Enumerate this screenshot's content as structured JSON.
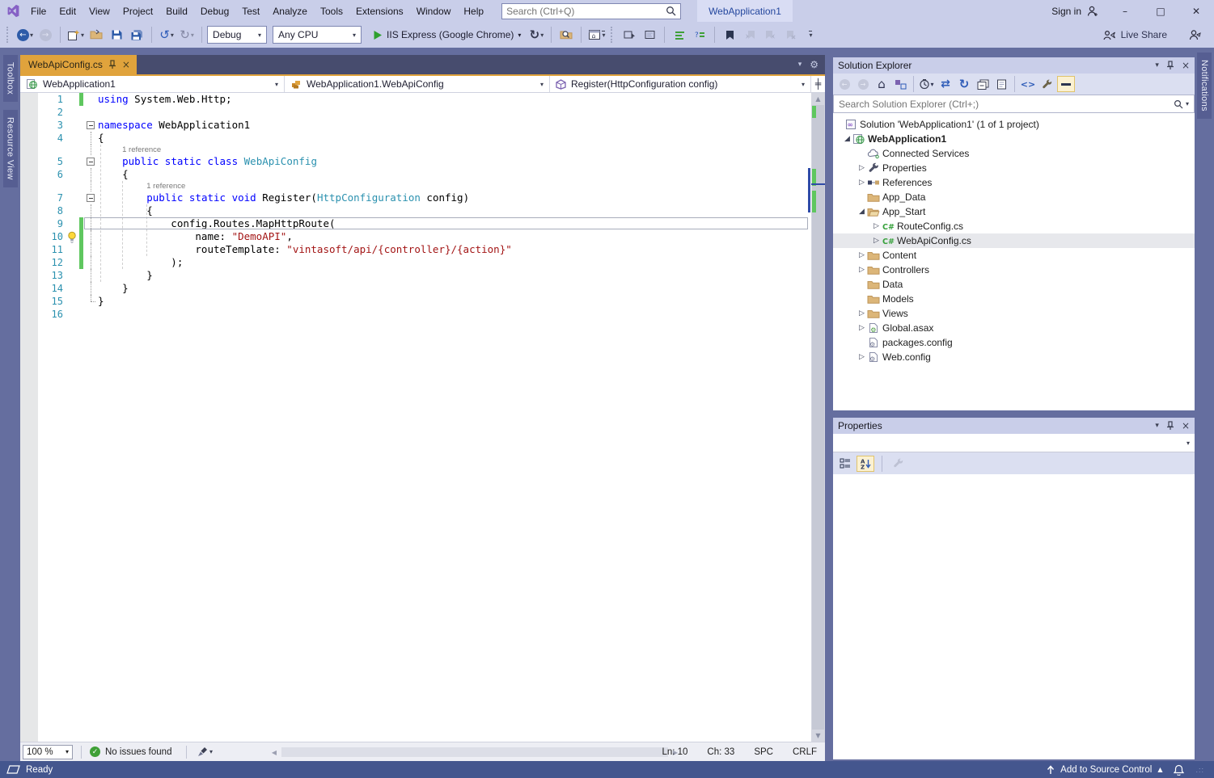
{
  "title_bar": {
    "menus": [
      "File",
      "Edit",
      "View",
      "Project",
      "Build",
      "Debug",
      "Test",
      "Analyze",
      "Tools",
      "Extensions",
      "Window",
      "Help"
    ],
    "search_placeholder": "Search (Ctrl+Q)",
    "window_title": "WebApplication1",
    "sign_in_label": "Sign in"
  },
  "toolbar": {
    "debug_config": "Debug",
    "platform": "Any CPU",
    "start_label": "IIS Express (Google Chrome)",
    "live_share_label": "Live Share",
    "icon_names": [
      "navigate-backward",
      "navigate-forward",
      "new-item",
      "open-file",
      "save",
      "save-all",
      "undo",
      "redo",
      "start-debug",
      "hot-reload",
      "find-in-files",
      "web-browser-home",
      "display-member-list",
      "display-parameter-info",
      "comment-out",
      "uncomment",
      "toggle-bookmark",
      "previous-bookmark",
      "next-bookmark",
      "clear-bookmarks",
      "toolbar-overflow",
      "live-share",
      "send-feedback"
    ]
  },
  "left_dock_tabs": [
    "Toolbox",
    "Resource View"
  ],
  "right_dock_tabs": [
    "Notifications"
  ],
  "editor": {
    "tab_label": "WebApiConfig.cs",
    "nav": {
      "project": "WebApplication1",
      "type": "WebApplication1.WebApiConfig",
      "member": "Register(HttpConfiguration config)"
    },
    "codelens_label": "1 reference",
    "lines": [
      {
        "n": "1",
        "bar": true,
        "segs": [
          [
            "k",
            "using"
          ],
          [
            "p",
            " System.Web.Http;"
          ]
        ]
      },
      {
        "n": "2",
        "segs": []
      },
      {
        "n": "3",
        "out": "box",
        "segs": [
          [
            "k",
            "namespace"
          ],
          [
            "p",
            " WebApplication1"
          ]
        ]
      },
      {
        "n": "4",
        "out": "v",
        "segs": [
          [
            "p",
            "{"
          ]
        ]
      },
      {
        "lens": true,
        "indent": 4
      },
      {
        "n": "5",
        "out": "box",
        "segs": [
          [
            "p",
            "    "
          ],
          [
            "k",
            "public"
          ],
          [
            "p",
            " "
          ],
          [
            "k",
            "static"
          ],
          [
            "p",
            " "
          ],
          [
            "k",
            "class"
          ],
          [
            "p",
            " "
          ],
          [
            "t",
            "WebApiConfig"
          ]
        ]
      },
      {
        "n": "6",
        "out": "v",
        "segs": [
          [
            "p",
            "    {"
          ]
        ]
      },
      {
        "lens": true,
        "indent": 8
      },
      {
        "n": "7",
        "out": "box",
        "segs": [
          [
            "p",
            "        "
          ],
          [
            "k",
            "public"
          ],
          [
            "p",
            " "
          ],
          [
            "k",
            "static"
          ],
          [
            "p",
            " "
          ],
          [
            "k",
            "void"
          ],
          [
            "p",
            " Register("
          ],
          [
            "t",
            "HttpConfiguration"
          ],
          [
            "p",
            " config)"
          ]
        ]
      },
      {
        "n": "8",
        "out": "v",
        "segs": [
          [
            "p",
            "        {"
          ]
        ]
      },
      {
        "n": "9",
        "out": "v",
        "bar": true,
        "segs": [
          [
            "p",
            "            config.Routes.MapHttpRoute("
          ]
        ]
      },
      {
        "n": "10",
        "out": "v",
        "bar": true,
        "bulb": true,
        "current": true,
        "segs": [
          [
            "p",
            "                name: "
          ],
          [
            "s",
            "\"DemoAPI\""
          ],
          [
            "p",
            ","
          ]
        ]
      },
      {
        "n": "11",
        "out": "v",
        "bar": true,
        "segs": [
          [
            "p",
            "                routeTemplate: "
          ],
          [
            "s",
            "\"vintasoft/api/{controller}/{action}\""
          ]
        ]
      },
      {
        "n": "12",
        "out": "v",
        "bar": true,
        "segs": [
          [
            "p",
            "            );"
          ]
        ]
      },
      {
        "n": "13",
        "out": "v",
        "segs": [
          [
            "p",
            "        }"
          ]
        ]
      },
      {
        "n": "14",
        "out": "v",
        "segs": [
          [
            "p",
            "    }"
          ]
        ]
      },
      {
        "n": "15",
        "out": "end",
        "segs": [
          [
            "p",
            "}"
          ]
        ]
      },
      {
        "n": "16",
        "segs": []
      }
    ],
    "zoom_level": "100 %",
    "health_text": "No issues found",
    "status": {
      "line": "Ln: 10",
      "column": "Ch: 33",
      "insert_mode": "SPC",
      "line_ending": "CRLF"
    }
  },
  "solution_explorer": {
    "title": "Solution Explorer",
    "search_placeholder": "Search Solution Explorer (Ctrl+;)",
    "toolbar_icon_names": [
      "back",
      "forward",
      "home",
      "switch-views",
      "pending-changes-filter",
      "sync-with-active-document",
      "refresh",
      "collapse-all",
      "show-all-files",
      "view-code",
      "properties",
      "preview-selected-items"
    ],
    "items": [
      {
        "label": "Solution 'WebApplication1' (1 of 1 project)",
        "level": 0,
        "icon": "solution"
      },
      {
        "label": "WebApplication1",
        "level": 1,
        "icon": "project-web",
        "expander": "expanded",
        "bold": true
      },
      {
        "label": "Connected Services",
        "level": 2,
        "icon": "connected-services"
      },
      {
        "label": "Properties",
        "level": 2,
        "icon": "wrench",
        "expander": "collapsed"
      },
      {
        "label": "References",
        "level": 2,
        "icon": "references",
        "expander": "collapsed"
      },
      {
        "label": "App_Data",
        "level": 2,
        "icon": "folder"
      },
      {
        "label": "App_Start",
        "level": 2,
        "icon": "folder-open",
        "expander": "expanded"
      },
      {
        "label": "RouteConfig.cs",
        "level": 3,
        "icon": "csharp",
        "expander": "collapsed"
      },
      {
        "label": "WebApiConfig.cs",
        "level": 3,
        "icon": "csharp",
        "expander": "collapsed",
        "selected": true
      },
      {
        "label": "Content",
        "level": 2,
        "icon": "folder",
        "expander": "collapsed"
      },
      {
        "label": "Controllers",
        "level": 2,
        "icon": "folder",
        "expander": "collapsed"
      },
      {
        "label": "Data",
        "level": 2,
        "icon": "folder"
      },
      {
        "label": "Models",
        "level": 2,
        "icon": "folder"
      },
      {
        "label": "Views",
        "level": 2,
        "icon": "folder",
        "expander": "collapsed"
      },
      {
        "label": "Global.asax",
        "level": 2,
        "icon": "global-asax",
        "expander": "collapsed"
      },
      {
        "label": "packages.config",
        "level": 2,
        "icon": "config"
      },
      {
        "label": "Web.config",
        "level": 2,
        "icon": "config",
        "expander": "collapsed"
      }
    ]
  },
  "properties_panel": {
    "title": "Properties",
    "toolbar_icon_names": [
      "categorized",
      "alphabetical",
      "property-pages"
    ]
  },
  "status_bar": {
    "ready_label": "Ready",
    "source_control_label": "Add to Source Control"
  },
  "colors": {
    "accent_gold": "#E0A33C",
    "chrome": "#C9CEE9",
    "tab_well": "#474C6E",
    "status_bar": "#44568E",
    "main_background": "#656E9F",
    "keyword": "#0000FF",
    "type_name": "#2B91AF",
    "string": "#A31515",
    "line_number": "#2B91AF",
    "change_tracking": "#5FC75F"
  }
}
